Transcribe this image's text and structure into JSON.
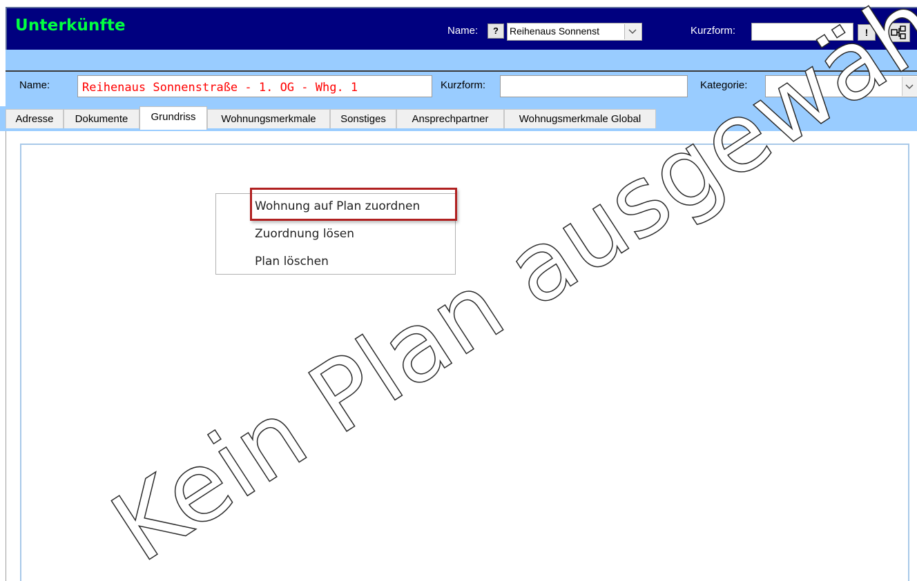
{
  "header": {
    "title": "Unterkünfte",
    "name_label": "Name:",
    "help_button": "?",
    "name_value": "Reihenaus Sonnenst",
    "kurzform_label": "Kurzform:",
    "kurzform_value": "",
    "excl_button": "!",
    "tree_icon": "hierarchy-icon"
  },
  "record": {
    "name_label": "Name:",
    "name_value": "Reihenaus Sonnenstraße - 1. OG - Whg. 1",
    "kurzform_label": "Kurzform:",
    "kurzform_value": "",
    "kategorie_label": "Kategorie:",
    "kategorie_value": ""
  },
  "tabs": [
    {
      "label": "Adresse"
    },
    {
      "label": "Dokumente"
    },
    {
      "label": "Grundriss"
    },
    {
      "label": "Wohnungsmerkmale"
    },
    {
      "label": "Sonstiges"
    },
    {
      "label": "Ansprechpartner"
    },
    {
      "label": "Wohnugsmerkmale Global"
    }
  ],
  "active_tab": "Grundriss",
  "plan": {
    "watermark": "Kein Plan ausgewählt"
  },
  "context_menu": {
    "items": [
      {
        "label": "Wohnung auf Plan zuordnen",
        "highlighted": true
      },
      {
        "label": "Zuordnung lösen"
      },
      {
        "label": "Plan löschen"
      }
    ]
  },
  "colors": {
    "header_bg": "#00007f",
    "title_color": "#00ff40",
    "band_bg": "#99ccff",
    "record_name_color": "#ff0000",
    "highlight_border": "#b02020"
  }
}
